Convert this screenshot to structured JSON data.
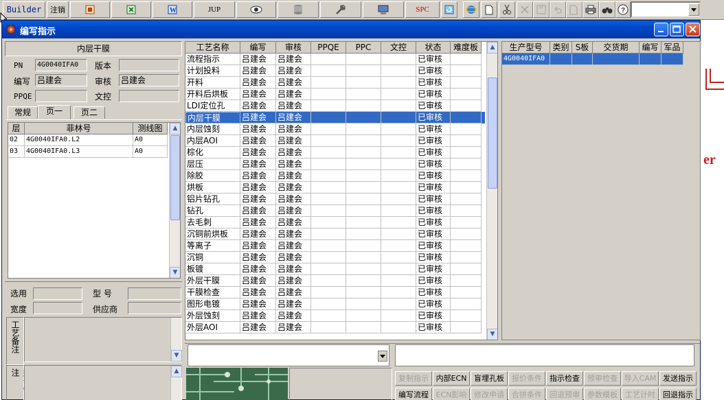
{
  "toolbar": {
    "builder_label": "Builder",
    "logout_label": "注销",
    "jup_label": "JUP",
    "spc_label": "SPC",
    "icons": [
      "ppt-icon",
      "excel-icon",
      "word-icon",
      "eye-icon",
      "database-icon",
      "tools-icon",
      "monitor-icon",
      "refresh-icon",
      "ie-icon",
      "new-file-icon",
      "cut-icon",
      "close-x-icon",
      "save-icon",
      "undo-icon",
      "copy-icon",
      "print-icon",
      "binoculars-icon",
      "help-icon"
    ],
    "dropdown_value": ""
  },
  "window": {
    "title": "编写指示"
  },
  "left_panel": {
    "title": "内层干膜",
    "pn_label": "PN",
    "pn_value": "4G0040IFA0",
    "version_label": "版本",
    "version_value": "",
    "author_label": "编写",
    "author_value": "吕建会",
    "reviewer_label": "审核",
    "reviewer_value": "吕建会",
    "ppqe_label": "PPQE",
    "ppqe_value": "",
    "ctrl_label": "文控",
    "ctrl_value": "",
    "tabs": [
      "常规",
      "页一",
      "页二"
    ],
    "active_tab": 1,
    "layer_headers": [
      "层",
      "菲林号",
      "测线图"
    ],
    "layer_rows": [
      [
        "02",
        "4G0040IFA0.L2",
        "A0"
      ],
      [
        "03",
        "4G0040IFA0.L3",
        "A0"
      ]
    ],
    "select_label": "选用",
    "model_label": "型  号",
    "width_label": "宽度",
    "supplier_label": "供应商",
    "process_note_label": "工艺备注",
    "model_note_label": "型号备注"
  },
  "process_grid": {
    "headers": [
      "工艺名称",
      "编写",
      "审核",
      "PPQE",
      "PPC",
      "文控",
      "状态",
      "难度板"
    ],
    "selected_index": 5,
    "rows": [
      [
        "流程指示",
        "吕建会",
        "吕建会",
        "",
        "",
        "",
        "已审核",
        ""
      ],
      [
        "计划投料",
        "吕建会",
        "吕建会",
        "",
        "",
        "",
        "已审核",
        ""
      ],
      [
        "开料",
        "吕建会",
        "吕建会",
        "",
        "",
        "",
        "已审核",
        ""
      ],
      [
        "开料后烘板",
        "吕建会",
        "吕建会",
        "",
        "",
        "",
        "已审核",
        ""
      ],
      [
        "LDI定位孔",
        "吕建会",
        "吕建会",
        "",
        "",
        "",
        "已审核",
        ""
      ],
      [
        "内层干膜",
        "吕建会",
        "吕建会",
        "",
        "",
        "",
        "已审核",
        ""
      ],
      [
        "内层蚀刻",
        "吕建会",
        "吕建会",
        "",
        "",
        "",
        "已审核",
        ""
      ],
      [
        "内层AOI",
        "吕建会",
        "吕建会",
        "",
        "",
        "",
        "已审核",
        ""
      ],
      [
        "棕化",
        "吕建会",
        "吕建会",
        "",
        "",
        "",
        "已审核",
        ""
      ],
      [
        "层压",
        "吕建会",
        "吕建会",
        "",
        "",
        "",
        "已审核",
        ""
      ],
      [
        "除胶",
        "吕建会",
        "吕建会",
        "",
        "",
        "",
        "已审核",
        ""
      ],
      [
        "烘板",
        "吕建会",
        "吕建会",
        "",
        "",
        "",
        "已审核",
        ""
      ],
      [
        "铝片钻孔",
        "吕建会",
        "吕建会",
        "",
        "",
        "",
        "已审核",
        ""
      ],
      [
        "钻孔",
        "吕建会",
        "吕建会",
        "",
        "",
        "",
        "已审核",
        ""
      ],
      [
        "去毛刺",
        "吕建会",
        "吕建会",
        "",
        "",
        "",
        "已审核",
        ""
      ],
      [
        "沉铜前烘板",
        "吕建会",
        "吕建会",
        "",
        "",
        "",
        "已审核",
        ""
      ],
      [
        "等离子",
        "吕建会",
        "吕建会",
        "",
        "",
        "",
        "已审核",
        ""
      ],
      [
        "沉铜",
        "吕建会",
        "吕建会",
        "",
        "",
        "",
        "已审核",
        ""
      ],
      [
        "板镀",
        "吕建会",
        "吕建会",
        "",
        "",
        "",
        "已审核",
        ""
      ],
      [
        "外层干膜",
        "吕建会",
        "吕建会",
        "",
        "",
        "",
        "已审核",
        ""
      ],
      [
        "干膜检查",
        "吕建会",
        "吕建会",
        "",
        "",
        "",
        "已审核",
        ""
      ],
      [
        "图形电镀",
        "吕建会",
        "吕建会",
        "",
        "",
        "",
        "已审核",
        ""
      ],
      [
        "外层蚀刻",
        "吕建会",
        "吕建会",
        "",
        "",
        "",
        "已审核",
        ""
      ],
      [
        "外层AOI",
        "吕建会",
        "吕建会",
        "",
        "",
        "",
        "已审核",
        ""
      ]
    ]
  },
  "product_grid": {
    "headers": [
      "生产型号",
      "类别",
      "S板",
      "交货期",
      "编写",
      "军品"
    ],
    "rows": [
      [
        "4G0040IFA0",
        "",
        "",
        "",
        "",
        ""
      ]
    ]
  },
  "buttons_row1": [
    {
      "label": "复制指示",
      "enabled": false
    },
    {
      "label": "内部ECN",
      "enabled": true
    },
    {
      "label": "盲埋孔板",
      "enabled": true
    },
    {
      "label": "报价条件",
      "enabled": false
    },
    {
      "label": "指示检查",
      "enabled": true
    },
    {
      "label": "预审检查",
      "enabled": false
    },
    {
      "label": "导入CAM",
      "enabled": false
    },
    {
      "label": "发送指示",
      "enabled": true
    }
  ],
  "buttons_row2": [
    {
      "label": "编写流程",
      "enabled": true
    },
    {
      "label": "ECN影响",
      "enabled": false
    },
    {
      "label": "修改申请",
      "enabled": false
    },
    {
      "label": "合拼条件",
      "enabled": false
    },
    {
      "label": "回退预审",
      "enabled": false
    },
    {
      "label": "参数模板",
      "enabled": false
    },
    {
      "label": "工艺计时",
      "enabled": false
    },
    {
      "label": "回退指示",
      "enabled": true
    }
  ],
  "background_fragment": "er",
  "colors": {
    "title_bar": "#0046c8",
    "selection": "#316ac5",
    "spc_red": "#d40000"
  }
}
